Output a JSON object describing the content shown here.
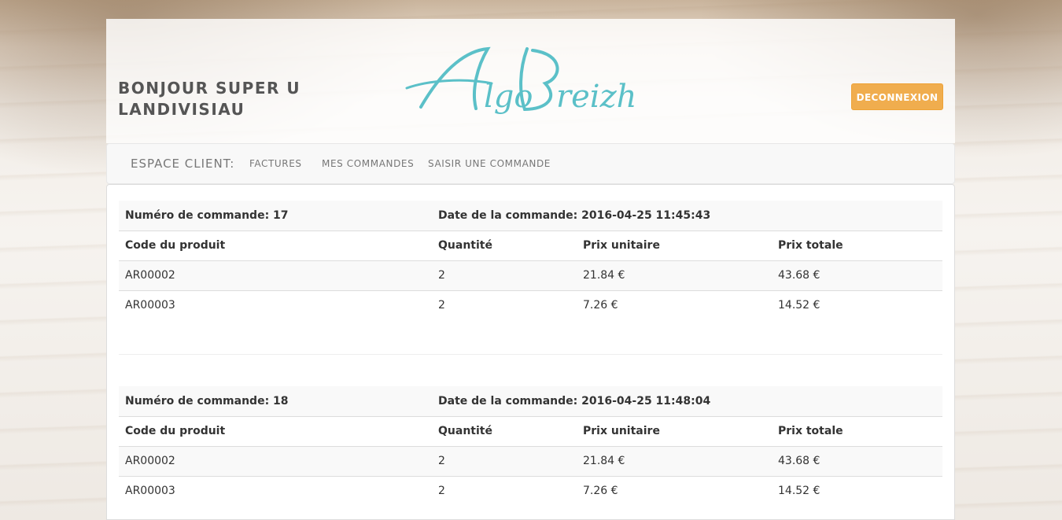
{
  "header": {
    "greeting": "BONJOUR SUPER U LANDIVISIAU",
    "logo_text": "AlgoBreizh",
    "logout_label": "DECONNEXION"
  },
  "nav": {
    "brand": "ESPACE CLIENT:",
    "links": [
      "FACTURES",
      "MES COMMANDES",
      "SAISIR UNE COMMANDE"
    ]
  },
  "orders": [
    {
      "number_label": "Numéro de commande: 17",
      "date_label": "Date de la commande: 2016-04-25 11:45:43",
      "columns": [
        "Code du produit",
        "Quantité",
        "Prix unitaire",
        "Prix totale"
      ],
      "rows": [
        [
          "AR00002",
          "2",
          "21.84 €",
          "43.68 €"
        ],
        [
          "AR00003",
          "2",
          "7.26 €",
          "14.52 €"
        ]
      ]
    },
    {
      "number_label": "Numéro de commande: 18",
      "date_label": "Date de la commande: 2016-04-25 11:48:04",
      "columns": [
        "Code du produit",
        "Quantité",
        "Prix unitaire",
        "Prix totale"
      ],
      "rows": [
        [
          "AR00002",
          "2",
          "21.84 €",
          "43.68 €"
        ],
        [
          "AR00003",
          "2",
          "7.26 €",
          "14.52 €"
        ]
      ]
    }
  ],
  "colors": {
    "logo": "#5bc0c8",
    "logout_bg": "#f0ad4e"
  }
}
